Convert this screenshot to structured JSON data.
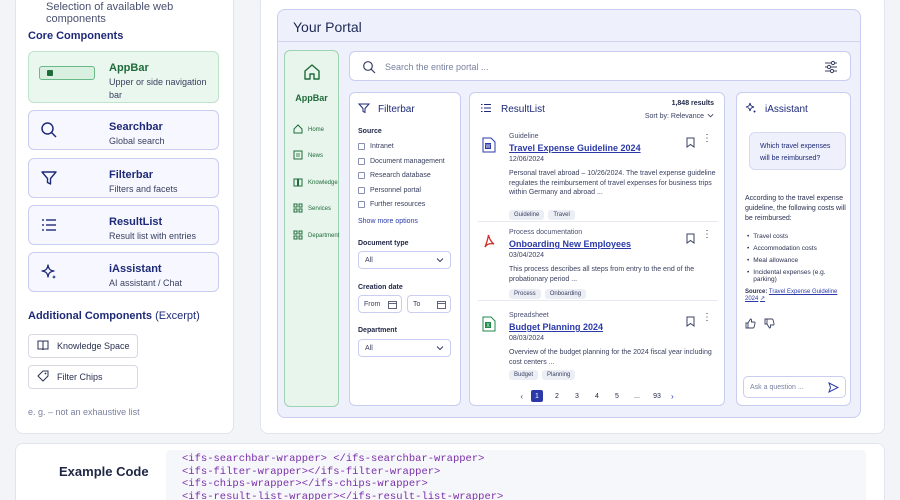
{
  "sidebar": {
    "subtitle": "Selection of available web components",
    "core_heading": "Core Components",
    "cards": [
      {
        "title": "AppBar",
        "desc": "Upper or side navigation bar",
        "icon": "appbar-icon"
      },
      {
        "title": "Searchbar",
        "desc": "Global search",
        "icon": "search-icon"
      },
      {
        "title": "Filterbar",
        "desc": "Filters and facets",
        "icon": "filter-icon"
      },
      {
        "title": "ResultList",
        "desc": "Result list with entries",
        "icon": "list-icon"
      },
      {
        "title": "iAssistant",
        "desc": "AI assistant / Chat",
        "icon": "sparkle-icon"
      }
    ],
    "additional_heading": "Additional Components",
    "additional_note": "(Excerpt)",
    "additional": [
      {
        "label": "Knowledge Space",
        "icon": "book-icon"
      },
      {
        "label": "Filter Chips",
        "icon": "tag-icon"
      }
    ],
    "footnote": "e. g. – not an exhaustive list"
  },
  "portal": {
    "title": "Your Portal",
    "appbar": {
      "title": "AppBar",
      "items": [
        {
          "label": "Home",
          "icon": "home-icon"
        },
        {
          "label": "News",
          "icon": "news-icon"
        },
        {
          "label": "Knowledge",
          "icon": "book-icon"
        },
        {
          "label": "Services",
          "icon": "grid-icon"
        },
        {
          "label": "Department",
          "icon": "grid-icon"
        }
      ]
    },
    "search": {
      "placeholder": "Search the entire portal ..."
    },
    "filterbar": {
      "title": "Filterbar",
      "source_label": "Source",
      "sources": [
        "Intranet",
        "Document management",
        "Research database",
        "Personnel portal",
        "Further resources"
      ],
      "show_more": "Show more options",
      "doctype_label": "Document type",
      "doctype_value": "All",
      "creation_label": "Creation date",
      "from": "From",
      "to": "To",
      "department_label": "Department",
      "department_value": "All"
    },
    "resultlist": {
      "title": "ResultList",
      "count": "1,848 results",
      "sort": "Sort by: Relevance",
      "items": [
        {
          "category": "Guideline",
          "title": "Travel Expense Guideline 2024",
          "date": "12/06/2024",
          "desc": "Personal travel abroad – 10/26/2024. The travel expense guideline regulates the reimbursement of travel expenses for business trips within Germany and abroad ...",
          "tags": [
            "Guideline",
            "Travel"
          ],
          "icon": "word-doc-icon"
        },
        {
          "category": "Process documentation",
          "title": "Onboarding New Employees",
          "date": "03/04/2024",
          "desc": "This process describes all steps from entry to the end of the probationary period ...",
          "tags": [
            "Process",
            "Onboarding"
          ],
          "icon": "pdf-icon"
        },
        {
          "category": "Spreadsheet",
          "title": "Budget Planning 2024",
          "date": "08/03/2024",
          "desc": "Overview of the budget planning for the 2024 fiscal year including cost centers ...",
          "tags": [
            "Budget",
            "Planning"
          ],
          "icon": "excel-icon"
        }
      ],
      "pages": [
        "1",
        "2",
        "3",
        "4",
        "5",
        "...",
        "93"
      ]
    },
    "assistant": {
      "title": "iAssistant",
      "question": "Which travel expenses will be reimbursed?",
      "answer": "According to the travel expense guideline, the following costs will be reimbursed:",
      "bullets": [
        "Travel costs",
        "Accommodation costs",
        "Meal allowance",
        "Incidental expenses (e.g. parking)"
      ],
      "source_label": "Source:",
      "source_link": "Travel Expense Guideline 2024",
      "input_placeholder": "Ask a question ..."
    }
  },
  "example": {
    "label": "Example Code",
    "lines": [
      "<ifs-searchbar-wrapper> </ifs-searchbar-wrapper>",
      "<ifs-filter-wrapper></ifs-filter-wrapper>",
      "<ifs-chips-wrapper></ifs-chips-wrapper>",
      "<ifs-result-list-wrapper></ifs-result-list-wrapper>"
    ]
  },
  "colors": {
    "accent": "#2b3aa8",
    "appbar_green": "#1f6b3a",
    "code_purple": "#7b2fa8"
  }
}
